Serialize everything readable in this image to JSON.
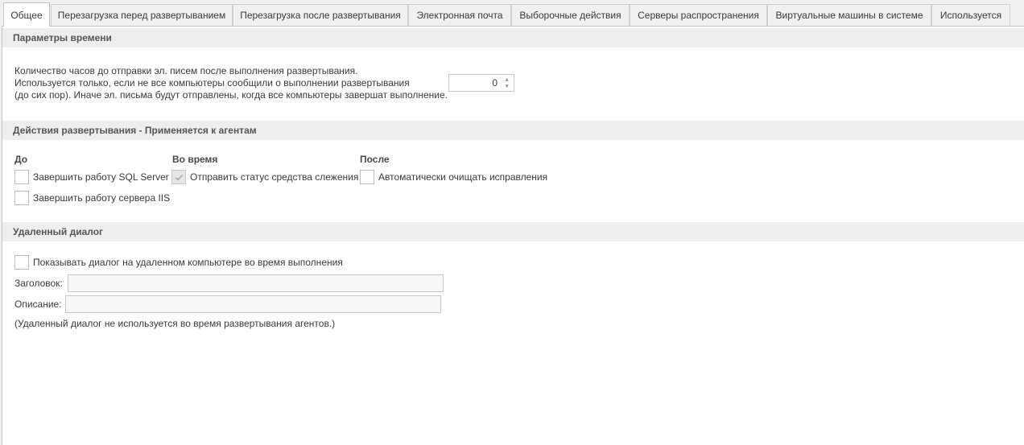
{
  "tabs": [
    {
      "label": "Общее"
    },
    {
      "label": "Перезагрузка перед развертыванием"
    },
    {
      "label": "Перезагрузка после развертывания"
    },
    {
      "label": "Электронная почта"
    },
    {
      "label": "Выборочные действия"
    },
    {
      "label": "Серверы распространения"
    },
    {
      "label": "Виртуальные машины в системе"
    },
    {
      "label": "Используется"
    }
  ],
  "time_params": {
    "header": "Параметры времени",
    "line1": "Количество часов до отправки эл. писем после выполнения развертывания.",
    "line2": "Используется только, если не все компьютеры сообщили о выполнении развертывания",
    "line3": "(до сих пор). Иначе эл. письма будут отправлены, когда все компьютеры завершат выполнение.",
    "hours_value": "0"
  },
  "deploy_actions": {
    "header": "Действия развертывания - Применяется к агентам",
    "before_label": "До",
    "during_label": "Во время",
    "after_label": "После",
    "stop_sql": "Завершить работу SQL Server",
    "stop_iis": "Завершить работу сервера IIS",
    "send_status": "Отправить статус средства слежения",
    "auto_clean": "Автоматически очищать исправления"
  },
  "remote_dialog": {
    "header": "Удаленный диалог",
    "show_dialog": "Показывать диалог на удаленном компьютере во время выполнения",
    "title_label": "Заголовок:",
    "title_value": "",
    "desc_label": "Описание:",
    "desc_value": "",
    "note": "(Удаленный диалог не используется во время развертывания агентов.)"
  }
}
